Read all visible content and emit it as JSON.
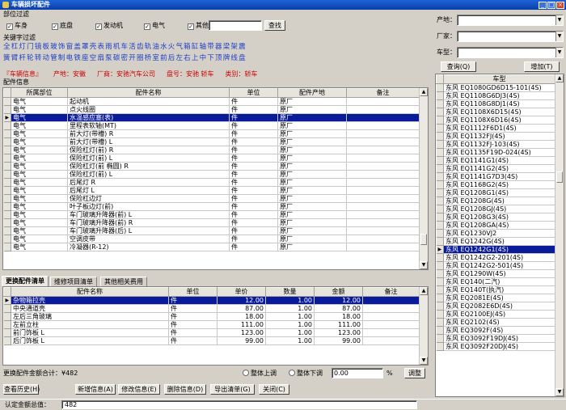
{
  "window": {
    "title": "车辆损坏配件"
  },
  "filter_section": {
    "label": "部位过滤",
    "checkboxes": [
      {
        "label": "车身",
        "checked": true
      },
      {
        "label": "底盘",
        "checked": true
      },
      {
        "label": "发动机",
        "checked": true
      },
      {
        "label": "电气",
        "checked": true
      },
      {
        "label": "其他",
        "checked": true
      }
    ],
    "search_value": "",
    "search_button": "查找"
  },
  "keyword_section": {
    "label": "关键字过滤",
    "row1": [
      "全",
      "杠",
      "灯",
      "门",
      "镜",
      "板",
      "玻",
      "饰",
      "窗",
      "盖",
      "罩",
      "壳",
      "表",
      "雨",
      "机",
      "车",
      "活",
      "齿",
      "轨",
      "油",
      "水",
      "火",
      "气",
      "箱",
      "缸",
      "轴",
      "带",
      "器",
      "梁",
      "架",
      "震"
    ],
    "row2": [
      "簧",
      "臂",
      "杆",
      "轮",
      "转",
      "动",
      "管",
      "制",
      "电",
      "铁",
      "座",
      "空",
      "扇",
      "泵",
      "碳",
      "密",
      "开",
      "圈",
      "桥",
      "室",
      "前",
      "后",
      "左",
      "右",
      "上",
      "中",
      "下",
      "顶",
      "牌",
      "线",
      "盘"
    ]
  },
  "vehicle_info": {
    "label": "『车辆信息』",
    "origin": "产地：安徽",
    "maker": "厂商：安驰汽车公司",
    "plate": "盘号：安驰  轿车",
    "category": "类别：轿车"
  },
  "parts_section": {
    "label": "配件信息",
    "columns": [
      "所属部位",
      "配件名称",
      "单位",
      "配件产地",
      "备注"
    ],
    "selected_index": 2,
    "rows": [
      [
        "电气",
        "起动机",
        "件",
        "原厂",
        ""
      ],
      [
        "电气",
        "点火线圈",
        "件",
        "原厂",
        ""
      ],
      [
        "电气",
        "水温感应塞(表)",
        "件",
        "原厂",
        ""
      ],
      [
        "电气",
        "里程表软轴(MT)",
        "件",
        "原厂",
        ""
      ],
      [
        "电气",
        "前大灯(带槽) R",
        "件",
        "原厂",
        ""
      ],
      [
        "电气",
        "前大灯(带槽) L",
        "件",
        "原厂",
        ""
      ],
      [
        "电气",
        "保险杠灯(前) R",
        "件",
        "原厂",
        ""
      ],
      [
        "电气",
        "保险杠灯(前) L",
        "件",
        "原厂",
        ""
      ],
      [
        "电气",
        "保险杠灯(前 椭圆) R",
        "件",
        "原厂",
        ""
      ],
      [
        "电气",
        "保险杠灯(前) L",
        "件",
        "原厂",
        ""
      ],
      [
        "电气",
        "后尾灯 R",
        "件",
        "原厂",
        ""
      ],
      [
        "电气",
        "后尾灯 L",
        "件",
        "原厂",
        ""
      ],
      [
        "电气",
        "保险杠边灯",
        "件",
        "原厂",
        ""
      ],
      [
        "电气",
        "叶子板边灯(前)",
        "件",
        "原厂",
        ""
      ],
      [
        "电气",
        "车门玻璃升降器(前) L",
        "件",
        "原厂",
        ""
      ],
      [
        "电气",
        "车门玻璃升降器(前) R",
        "件",
        "原厂",
        ""
      ],
      [
        "电气",
        "车门玻璃升降器(后) L",
        "件",
        "原厂",
        ""
      ],
      [
        "电气",
        "空调皮带",
        "件",
        "原厂",
        ""
      ],
      [
        "电气",
        "冷凝器(R-12)",
        "件",
        "原厂",
        ""
      ]
    ]
  },
  "tabs": [
    "更换配件清单",
    "维修项目清单",
    "其他相关费用"
  ],
  "replace_list": {
    "columns": [
      "配件名称",
      "单位",
      "单价",
      "数量",
      "金额",
      "备注"
    ],
    "selected_index": 0,
    "rows": [
      [
        "杂物箱拉壳",
        "件",
        "12.00",
        "1.00",
        "12.00",
        ""
      ],
      [
        "中央通道壳",
        "件",
        "87.00",
        "1.00",
        "87.00",
        ""
      ],
      [
        "左后三角玻璃",
        "件",
        "18.00",
        "1.00",
        "18.00",
        ""
      ],
      [
        "左前立柱",
        "件",
        "111.00",
        "1.00",
        "111.00",
        ""
      ],
      [
        "前门饰板 L",
        "件",
        "123.00",
        "1.00",
        "123.00",
        ""
      ],
      [
        "后门饰板 L",
        "件",
        "99.00",
        "1.00",
        "99.00",
        ""
      ]
    ]
  },
  "totals": {
    "label": "更换配件金额合计：¥482",
    "radio_up": "整体上调",
    "radio_down": "整体下调",
    "adjust_value": "0.00",
    "percent": "%",
    "adjust_button": "调整"
  },
  "buttons": [
    "查看历史(H)",
    "新增信息(A)",
    "修改信息(E)",
    "删除信息(D)",
    "导出清单(G)",
    "关闭(C)"
  ],
  "status": {
    "label": "认定金额总值：",
    "value": "482"
  },
  "right_panel": {
    "origin_label": "产地：",
    "maker_label": "厂家：",
    "model_label": "车型：",
    "query_button": "查询(Q)",
    "add_button": "增加(T)",
    "list_header": "车型",
    "selected_index": 20,
    "models": [
      "东风 EQ1080GD6D15-101(4S)",
      "东风 EQ1108G6DJ3(4S)",
      "东风 EQ1108G8DJ1(4S)",
      "东风 EQ1108X6D15(4S)",
      "东风 EQ1108X6D16(4S)",
      "东风 EQ1112F6D1(4S)",
      "东风 EQ1132FJ(4S)",
      "东风 EQ1132FJ-103(4S)",
      "东风 EQ1135F19D-024(4S)",
      "东风 EQ1141G1(4S)",
      "东风 EQ1141G2(4S)",
      "东风 EQ1141G7D3(4S)",
      "东风 EQ1168G2(4S)",
      "东风 EQ1208G1(4S)",
      "东风 EQ1208G(4S)",
      "东风 EQ1208GJ(4S)",
      "东风 EQ1208G3(4S)",
      "东风 EQ1208GA(4S)",
      "东风 EQ1230VJ2",
      "东风 EQ1242G(4S)",
      "东风 EQ1242G1(4S)",
      "东风 EQ1242G2-201(4S)",
      "东风 EQ1242G2-501(4S)",
      "东风 EQ1290W(4S)",
      "东风 EQ140(二汽)",
      "东风 EQ140T(执汽)",
      "东风 EQ2081E(4S)",
      "东风 EQ2082E6D(4S)",
      "东风 EQ2100EJ(4S)",
      "东风 EQ2102(4S)",
      "东风 EQ3092F(4S)",
      "东风 EQ3092F19DJ(4S)",
      "东风 EQ3092F20DJ(4S)"
    ]
  }
}
